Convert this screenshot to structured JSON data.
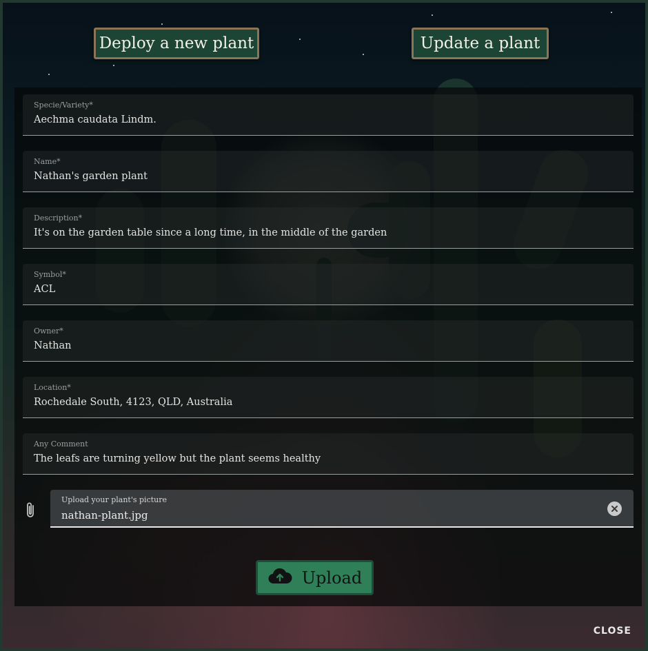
{
  "header": {
    "deploy_label": "Deploy a new plant",
    "update_label": "Update a plant"
  },
  "form": {
    "fields": [
      {
        "label": "Specie/Variety*",
        "value": "Aechma caudata Lindm."
      },
      {
        "label": "Name*",
        "value": "Nathan's garden plant"
      },
      {
        "label": "Description*",
        "value": "It's on the garden table since a long time, in the middle of the garden"
      },
      {
        "label": "Symbol*",
        "value": "ACL"
      },
      {
        "label": "Owner*",
        "value": "Nathan"
      },
      {
        "label": "Location*",
        "value": "Rochedale South, 4123, QLD, Australia"
      },
      {
        "label": "Any Comment",
        "value": "The leafs are turning yellow but the plant seems healthy"
      }
    ],
    "upload_field": {
      "label": "Upload your plant's picture",
      "value": "nathan-plant.jpg"
    },
    "upload_button_label": "Upload"
  },
  "footer": {
    "close_label": "CLOSE"
  },
  "icons": {
    "attach": "paperclip-icon",
    "clear": "clear-icon",
    "upload": "cloud-upload-icon"
  },
  "colors": {
    "button_bg": "#1c4536",
    "button_border": "#8a7556",
    "upload_button_bg": "#2f8059"
  }
}
